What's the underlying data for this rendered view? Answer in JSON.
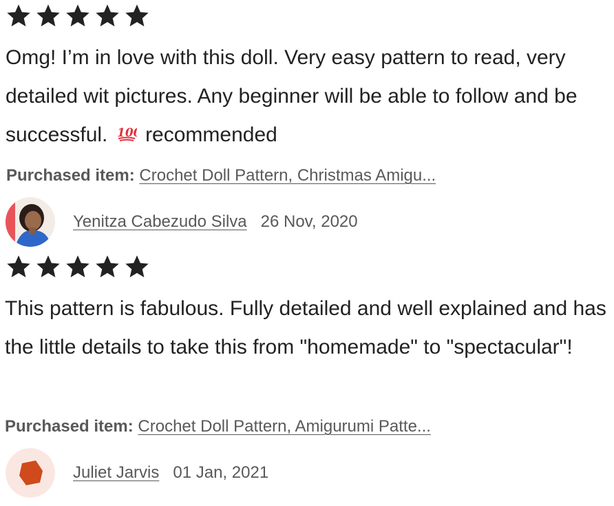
{
  "reviews": [
    {
      "rating": 5,
      "star_color": "#222222",
      "text_before_emoji": "Omg! I’m in love with this doll. Very easy pattern to read, very detailed wit pictures. Any beginner will be able to follow and be successful.",
      "emoji": "hundred-points-icon",
      "text_after_emoji": "recommended",
      "purchased_label": "Purchased item:",
      "purchased_item": "Crochet Doll Pattern, Christmas Amigu...",
      "reviewer_name": "Yenitza Cabezudo Silva",
      "date": "26 Nov, 2020",
      "avatar": "profile-photo"
    },
    {
      "rating": 5,
      "star_color": "#222222",
      "text": "This pattern is fabulous. Fully detailed and well explained and has the little details to take this from \"homemade\" to \"spectacular\"!",
      "purchased_label": "Purchased item:",
      "purchased_item": "Crochet Doll Pattern, Amigurumi Patte...",
      "reviewer_name": "Juliet Jarvis",
      "date": "01 Jan, 2021",
      "avatar": "default-avatar-icon",
      "avatar_colors": {
        "background": "#fbe7e1",
        "shape": "#cf4a1c"
      }
    }
  ]
}
